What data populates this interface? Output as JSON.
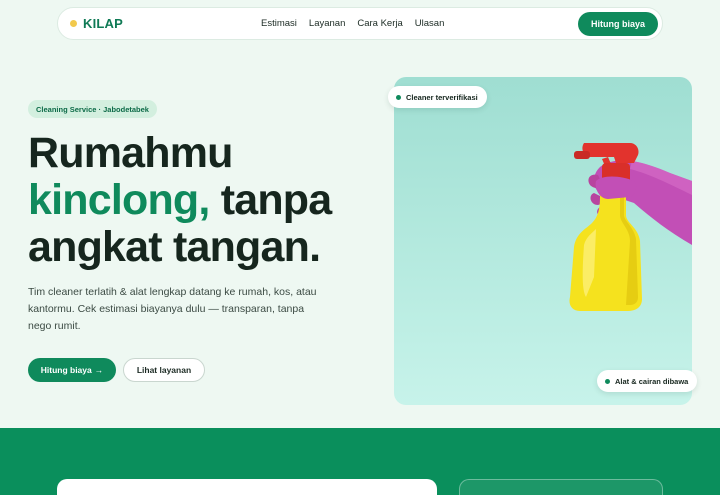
{
  "nav": {
    "brand": "KILAP",
    "links": [
      "Estimasi",
      "Layanan",
      "Cara Kerja",
      "Ulasan"
    ],
    "cta": "Hitung biaya"
  },
  "hero": {
    "badge": "Cleaning Service · Jabodetabek",
    "headline": {
      "line1": "Rumahmu",
      "accent": "kinclong,",
      "line2_rest": " tanpa",
      "line3": "angkat tangan."
    },
    "description": "Tim cleaner terlatih & alat lengkap datang ke rumah, kos, atau kantormu. Cek estimasi biayanya dulu — transparan, tanpa nego rumit.",
    "primary_button": "Hitung biaya",
    "primary_button_arrow": "→",
    "secondary_button": "Lihat layanan",
    "chips": {
      "top": "Cleaner terverifikasi",
      "bottom": "Alat & cairan dibawa"
    }
  },
  "colors": {
    "brand_green": "#0f8a5c",
    "brand_dot": "#f2c94c",
    "page_bg": "#eef8f2",
    "band_green": "#0a8f5c"
  }
}
